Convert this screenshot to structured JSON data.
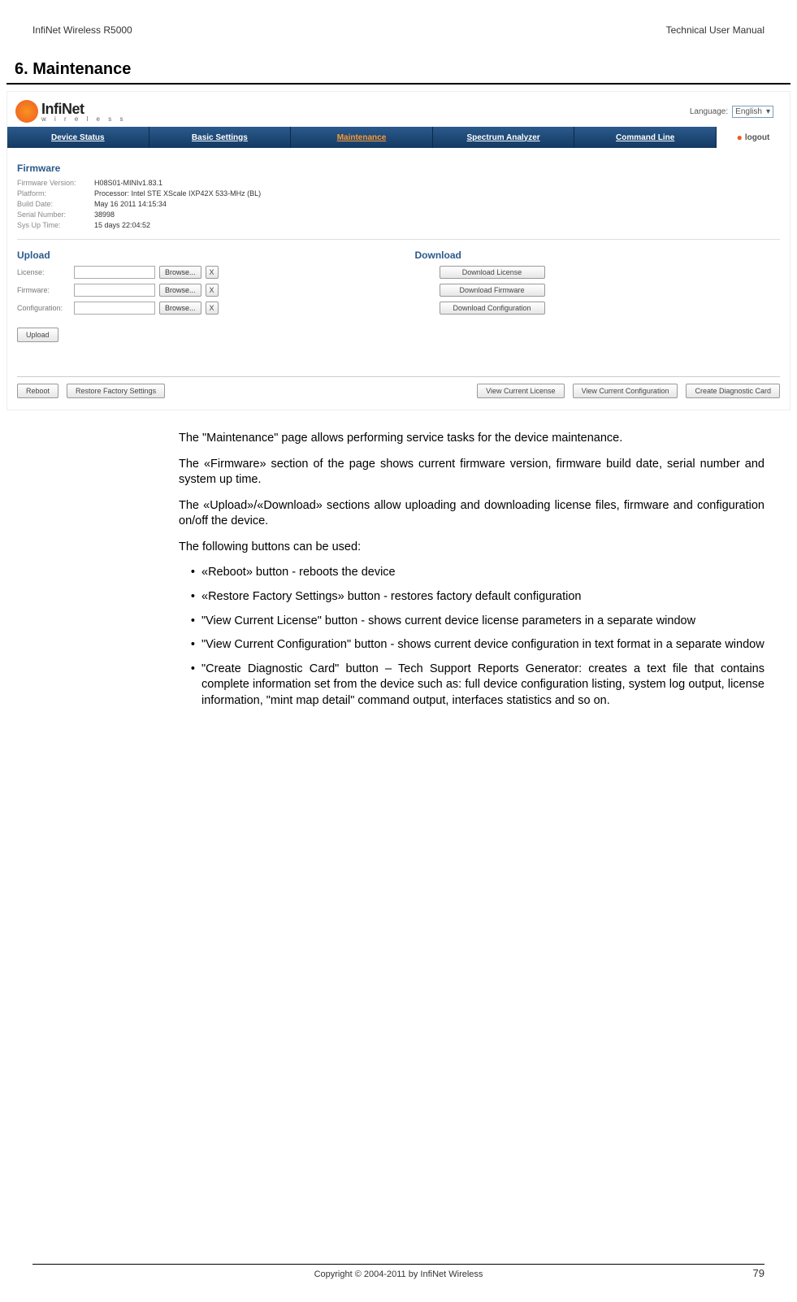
{
  "header": {
    "left": "InfiNet Wireless R5000",
    "right": "Technical User Manual"
  },
  "heading": "6. Maintenance",
  "screenshot": {
    "logo": {
      "brand": "InfiNet",
      "sub": "w i r e l e s s"
    },
    "language_label": "Language:",
    "language_value": "English",
    "tabs": {
      "device_status": "Device Status",
      "basic_settings": "Basic Settings",
      "maintenance": "Maintenance",
      "spectrum_analyzer": "Spectrum Analyzer",
      "command_line": "Command Line",
      "logout": "logout"
    },
    "firmware": {
      "title": "Firmware",
      "version_label": "Firmware Version:",
      "version_value": "H08S01-MINIv1.83.1",
      "platform_label": "Platform:",
      "platform_value": "Processor: Intel STE XScale IXP42X 533-MHz (BL)",
      "build_label": "Build Date:",
      "build_value": "May 16 2011 14:15:34",
      "serial_label": "Serial Number:",
      "serial_value": "38998",
      "uptime_label": "Sys Up Time:",
      "uptime_value": "15 days 22:04:52"
    },
    "upload": {
      "title": "Upload",
      "license_label": "License:",
      "firmware_label": "Firmware:",
      "config_label": "Configuration:",
      "browse": "Browse...",
      "x": "X",
      "upload_btn": "Upload"
    },
    "download": {
      "title": "Download",
      "license_btn": "Download License",
      "firmware_btn": "Download Firmware",
      "config_btn": "Download Configuration"
    },
    "footer": {
      "reboot": "Reboot",
      "restore": "Restore Factory Settings",
      "view_license": "View Current License",
      "view_config": "View Current Configuration",
      "diag_card": "Create Diagnostic Card"
    }
  },
  "body": {
    "p1": "The \"Maintenance\" page allows performing service tasks for the device maintenance.",
    "p2": "The «Firmware» section of the page shows current firmware version, firmware build date, serial number and system up time.",
    "p3": " The «Upload»/«Download» sections allow uploading and downloading license files, firmware and configuration on/off the device.",
    "p4": "The following buttons can be used:",
    "bullets": {
      "b1": "«Reboot» button - reboots the device",
      "b2": "«Restore Factory Settings» button - restores factory default configuration",
      "b3": " \"View Current License\" button - shows current device license parameters in a separate window",
      "b4": "\"View Current Configuration\" button - shows current device configuration in text format in a separate window",
      "b5": "\"Create Diagnostic Card\" button – Tech Support Reports Generator: creates a text file that contains complete information set from the device such as: full device configuration listing, system log output, license information, \"mint map detail\" command output, interfaces statistics and so on."
    }
  },
  "footer": {
    "copyright": "Copyright © 2004-2011 by InfiNet Wireless",
    "page": "79"
  }
}
